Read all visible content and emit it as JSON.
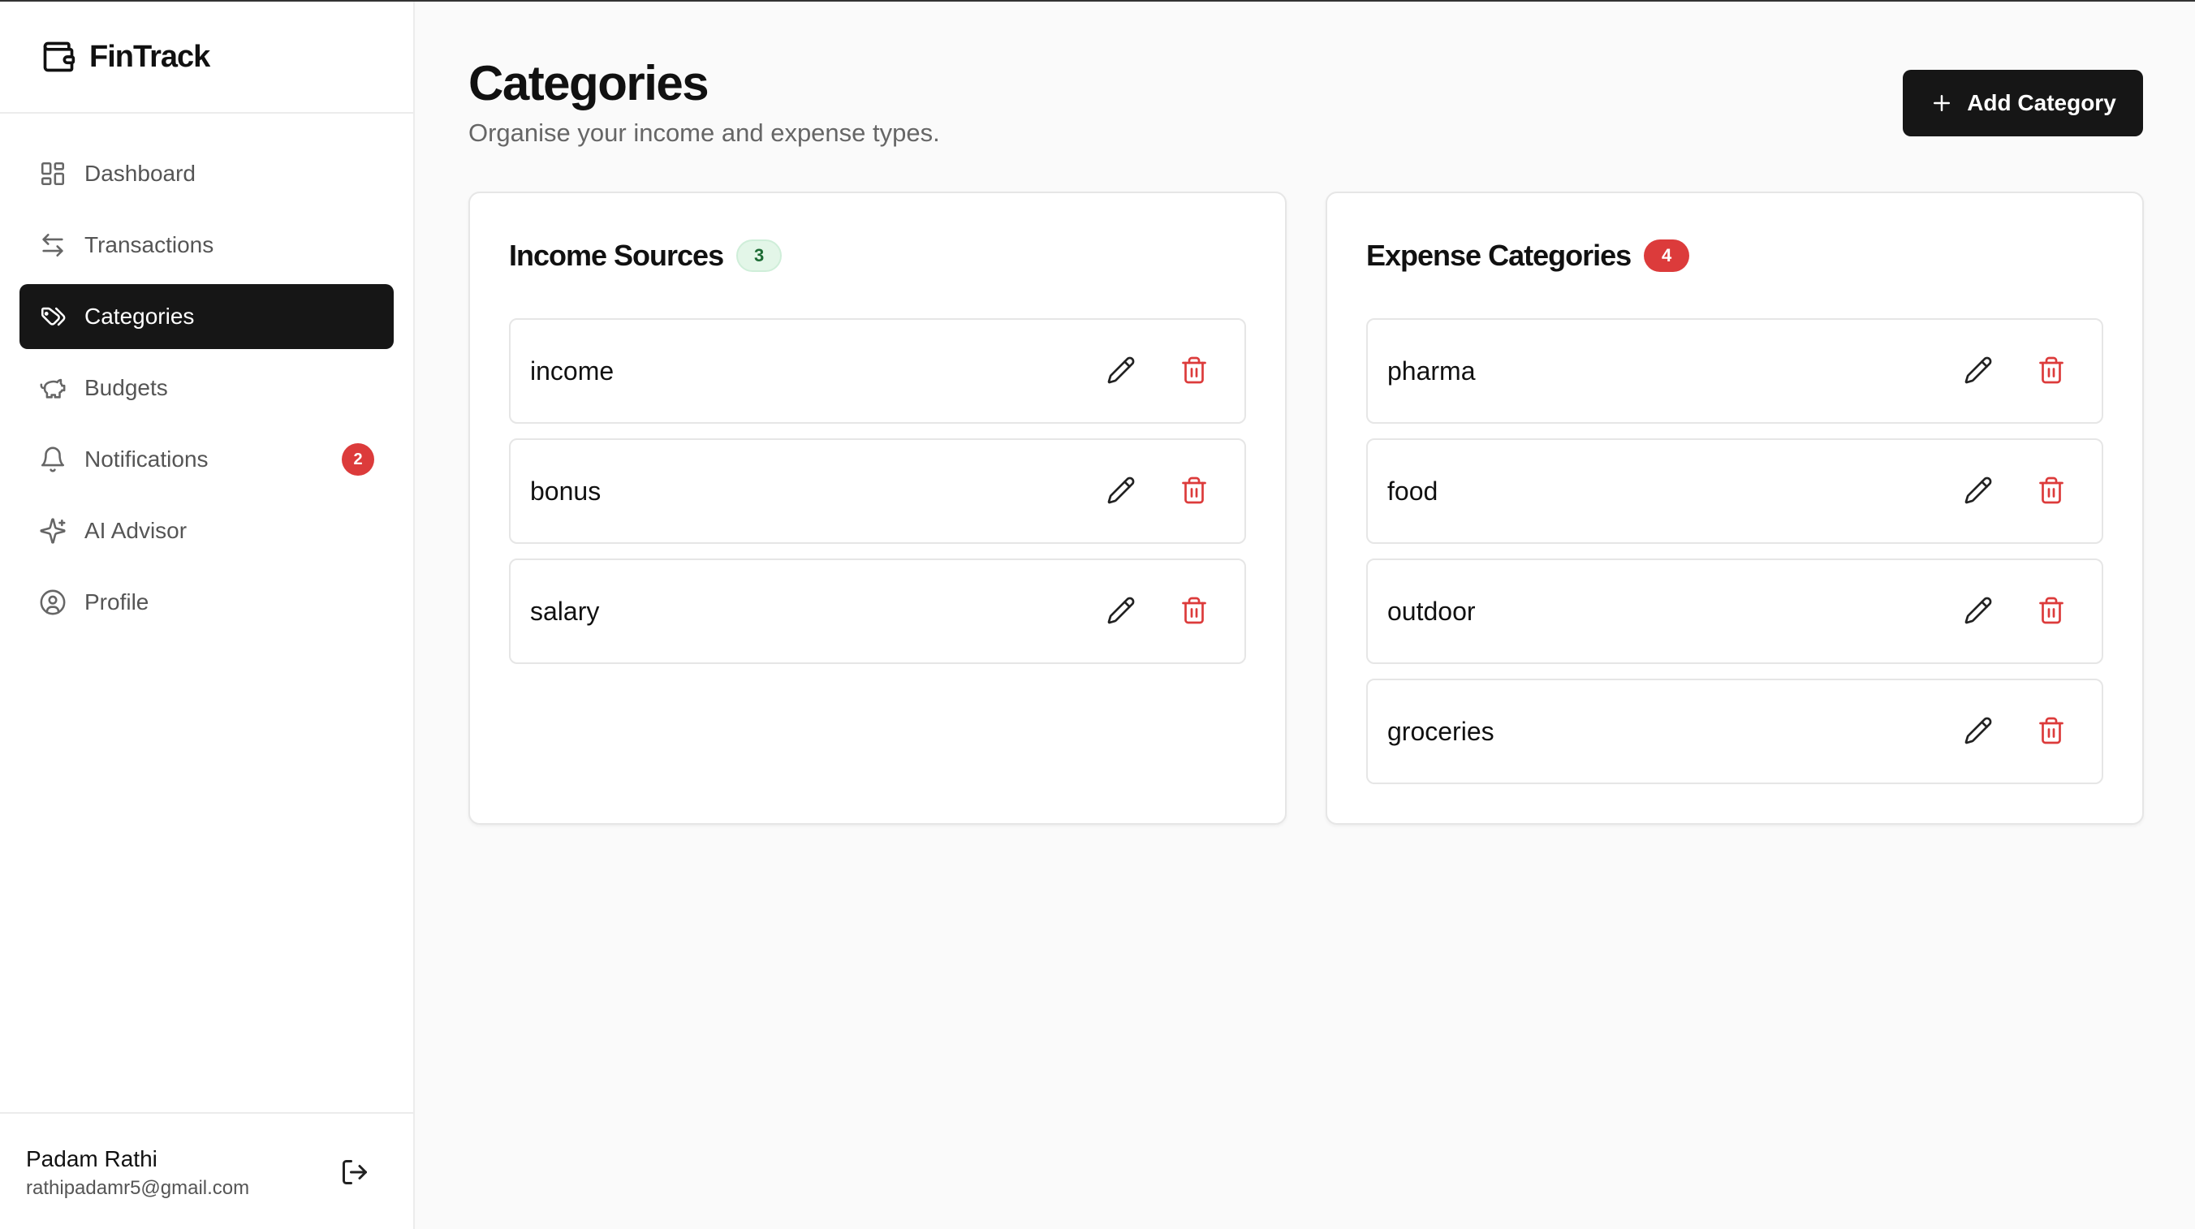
{
  "app": {
    "name": "FinTrack"
  },
  "sidebar": {
    "items": [
      {
        "label": "Dashboard",
        "icon": "dashboard-icon"
      },
      {
        "label": "Transactions",
        "icon": "transfer-arrows-icon"
      },
      {
        "label": "Categories",
        "icon": "tag-icon",
        "active": true
      },
      {
        "label": "Budgets",
        "icon": "piggy-bank-icon"
      },
      {
        "label": "Notifications",
        "icon": "bell-icon",
        "badge": "2"
      },
      {
        "label": "AI Advisor",
        "icon": "sparkles-icon"
      },
      {
        "label": "Profile",
        "icon": "user-circle-icon"
      }
    ],
    "user": {
      "name": "Padam Rathi",
      "email": "rathipadamr5@gmail.com"
    }
  },
  "header": {
    "title": "Categories",
    "subtitle": "Organise your income and expense types.",
    "add_label": "Add Category"
  },
  "income": {
    "title": "Income Sources",
    "count": "3",
    "items": [
      "income",
      "bonus",
      "salary"
    ]
  },
  "expense": {
    "title": "Expense Categories",
    "count": "4",
    "items": [
      "pharma",
      "food",
      "outdoor",
      "groceries"
    ]
  },
  "colors": {
    "accent": "#161616",
    "danger": "#dc3b3b",
    "income_badge_bg": "#e3f6e8",
    "income_badge_text": "#1d6b34"
  }
}
